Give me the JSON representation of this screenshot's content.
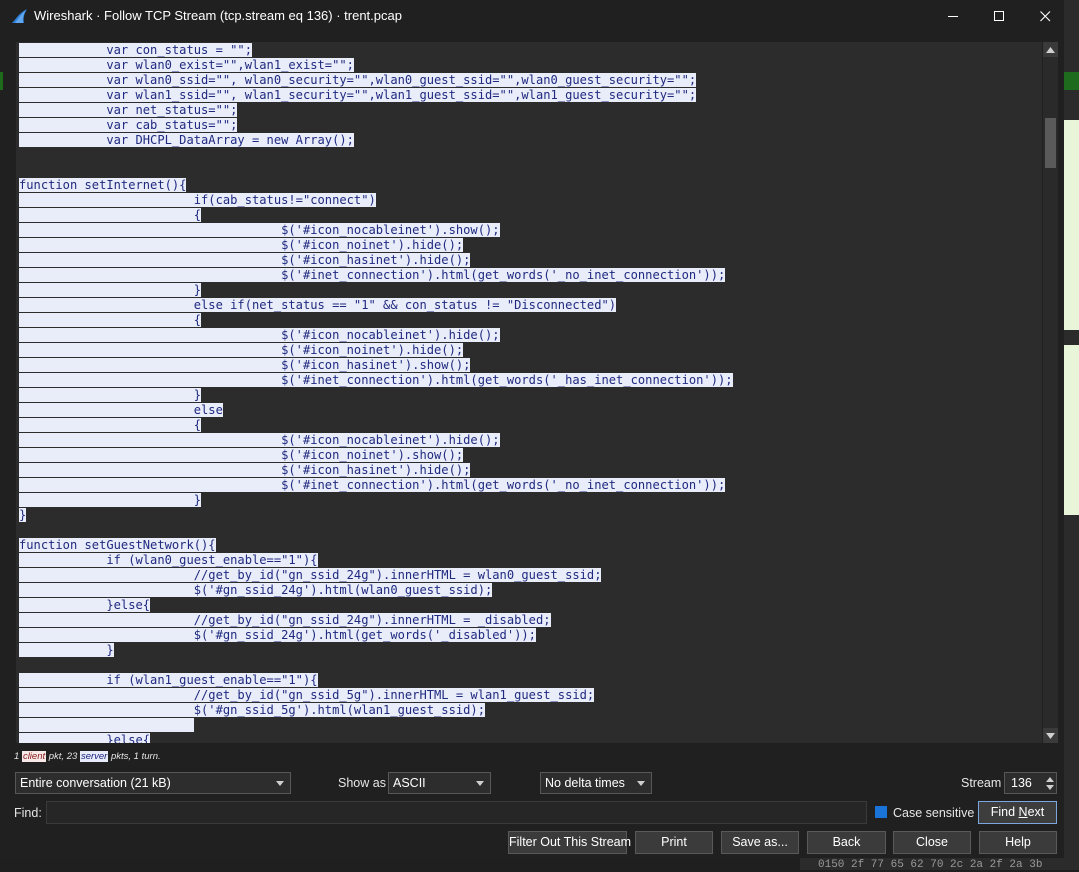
{
  "window": {
    "title": "Wireshark · Follow TCP Stream (tcp.stream eq 136) · trent.pcap",
    "icon": "wireshark-fin-icon",
    "controls": [
      "minimize-icon",
      "maximize-icon",
      "close-icon"
    ]
  },
  "stream_lines": [
    "            var con_status = \"\";",
    "            var wlan0_exist=\"\",wlan1_exist=\"\";",
    "            var wlan0_ssid=\"\", wlan0_security=\"\",wlan0_guest_ssid=\"\",wlan0_guest_security=\"\";",
    "            var wlan1_ssid=\"\", wlan1_security=\"\",wlan1_guest_ssid=\"\",wlan1_guest_security=\"\";",
    "            var net_status=\"\";",
    "            var cab_status=\"\";",
    "            var DHCPL_DataArray = new Array();",
    "",
    "",
    "function setInternet(){",
    "                        if(cab_status!=\"connect\")",
    "                        {",
    "                                    $('#icon_nocableinet').show();",
    "                                    $('#icon_noinet').hide();",
    "                                    $('#icon_hasinet').hide();",
    "                                    $('#inet_connection').html(get_words('_no_inet_connection'));",
    "                        }",
    "                        else if(net_status == \"1\" && con_status != \"Disconnected\")",
    "                        {",
    "                                    $('#icon_nocableinet').hide();",
    "                                    $('#icon_noinet').hide();",
    "                                    $('#icon_hasinet').show();",
    "                                    $('#inet_connection').html(get_words('_has_inet_connection'));",
    "                        }",
    "                        else",
    "                        {",
    "                                    $('#icon_nocableinet').hide();",
    "                                    $('#icon_noinet').show();",
    "                                    $('#icon_hasinet').hide();",
    "                                    $('#inet_connection').html(get_words('_no_inet_connection'));",
    "                        }",
    "}",
    "",
    "function setGuestNetwork(){",
    "            if (wlan0_guest_enable==\"1\"){",
    "                        //get_by_id(\"gn_ssid_24g\").innerHTML = wlan0_guest_ssid;",
    "                        $('#gn_ssid_24g').html(wlan0_guest_ssid);",
    "            }else{",
    "                        //get_by_id(\"gn_ssid_24g\").innerHTML = _disabled;",
    "                        $('#gn_ssid_24g').html(get_words('_disabled'));",
    "            }",
    "",
    "            if (wlan1_guest_enable==\"1\"){",
    "                        //get_by_id(\"gn_ssid_5g\").innerHTML = wlan1_guest_ssid;",
    "                        $('#gn_ssid_5g').html(wlan1_guest_ssid);",
    "                        ",
    "            }else{"
  ],
  "status": {
    "prefix": "1 ",
    "client": "client",
    "mid": " pkt, 23 ",
    "server": "server",
    "suffix": " pkts, 1 turn."
  },
  "controls": {
    "conversation": "Entire conversation (21 kB)",
    "show_as_label": "Show as",
    "show_as_value": "ASCII",
    "delta": "No delta times",
    "stream_label": "Stream",
    "stream_value": "136",
    "find_label": "Find:",
    "find_value": "",
    "case_sensitive_label": "Case sensitive",
    "case_sensitive_checked": true
  },
  "buttons": {
    "find_next_pre": "Find ",
    "find_next_u": "N",
    "find_next_post": "ext",
    "filter_out": "Filter Out This Stream",
    "print": "Print",
    "save_as": "Save as...",
    "back": "Back",
    "close": "Close",
    "help": "Help"
  },
  "background": {
    "hex_row": "0150  2f 77 65 62 70 2c 2a 2f  2a 3b"
  },
  "colors": {
    "stream_text": "#1f2a80",
    "stream_highlight": "#e9ecf9",
    "accent": "#1a73d9"
  }
}
